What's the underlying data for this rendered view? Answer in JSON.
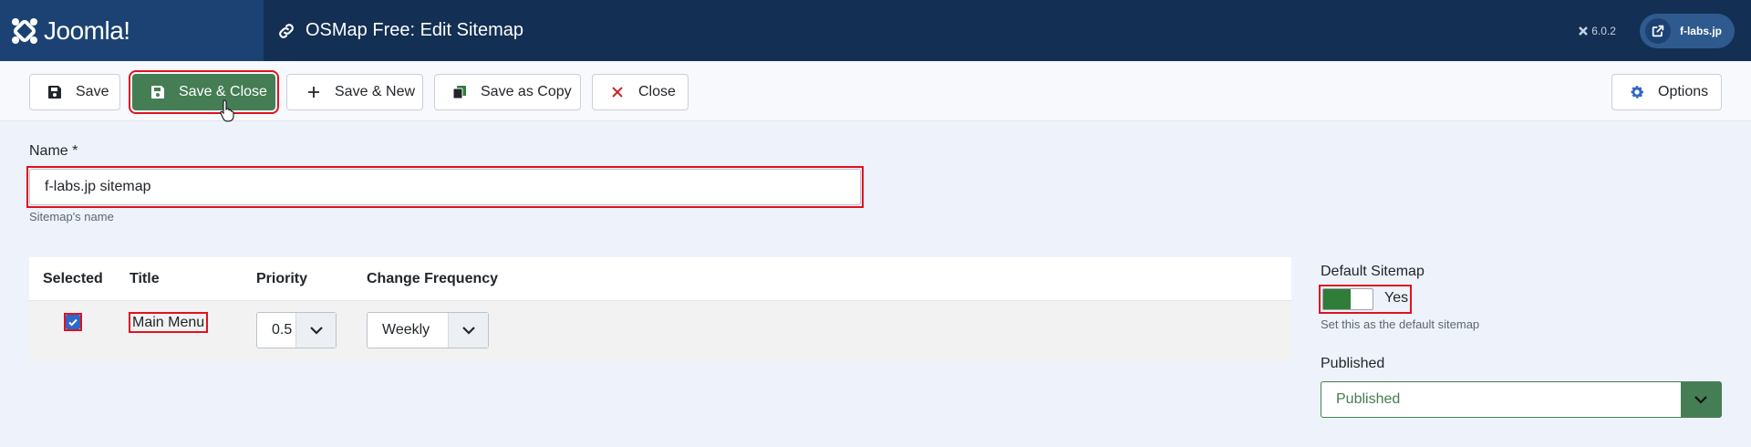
{
  "header": {
    "brand": "Joomla!",
    "title": "OSMap Free: Edit Sitemap",
    "version": "6.0.2",
    "site_link": "f-labs.jp"
  },
  "toolbar": {
    "save": "Save",
    "save_close": "Save & Close",
    "save_new": "Save & New",
    "save_copy": "Save as Copy",
    "close": "Close",
    "options": "Options"
  },
  "form": {
    "name_label": "Name *",
    "name_value": "f-labs.jp sitemap",
    "name_hint": "Sitemap's name"
  },
  "menus_table": {
    "headers": [
      "Selected",
      "Title",
      "Priority",
      "Change Frequency"
    ],
    "rows": [
      {
        "selected": true,
        "title": "Main Menu",
        "priority": "0.5",
        "change_frequency": "Weekly"
      }
    ]
  },
  "sidebar": {
    "default_label": "Default Sitemap",
    "default_value": "Yes",
    "default_hint": "Set this as the default sitemap",
    "published_label": "Published",
    "published_value": "Published"
  },
  "colors": {
    "header_bg": "#132f53",
    "brand_bg": "#1b4272",
    "success": "#457d54",
    "highlight": "#e0121f",
    "checkbox": "#2f68c6"
  }
}
